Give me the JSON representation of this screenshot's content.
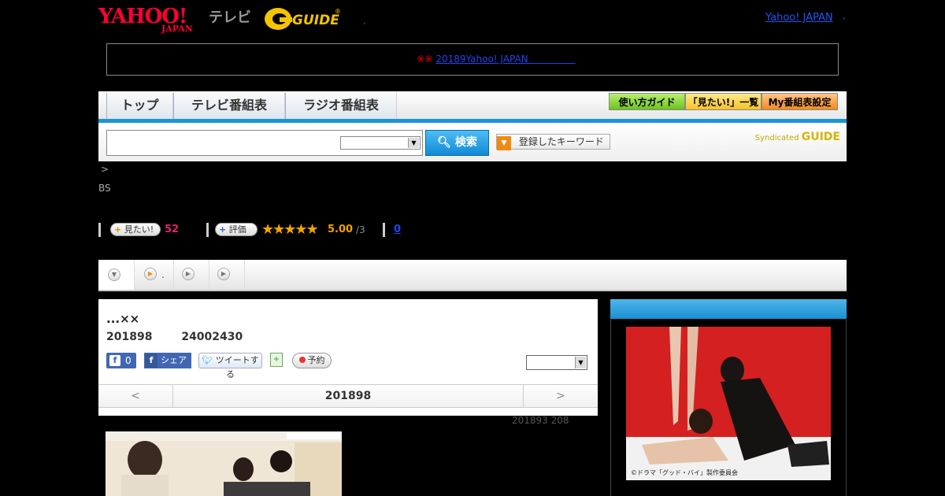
{
  "header": {
    "yahoo_logo_line1": "YAHOO!",
    "yahoo_logo_line2": "JAPAN",
    "tv_label": "テレビ",
    "gguide_logo": "GUIDE",
    "gguide_sep": ",",
    "yahoo_japan_link": "Yahoo! JAPAN",
    "yahoo_japan_sep": ","
  },
  "notice": {
    "marks": "※※",
    "link_text": "20189Yahoo! JAPAN　　　　　"
  },
  "nav": {
    "tabs": [
      "トップ",
      "テレビ番組表",
      "ラジオ番組表"
    ],
    "buttons": [
      "使い方ガイド",
      "「見たい!」一覧",
      "My番組表設定"
    ]
  },
  "search": {
    "placeholder": "",
    "select_value": "",
    "button_label": "検索",
    "keyword_button": "登録したキーワード",
    "syndicated_label": "Syndicated",
    "syndicated_brand": "GUIDE"
  },
  "breadcrumb": ">",
  "category": "BS",
  "stats": {
    "want_label": "見たい!",
    "want_count": "52",
    "rate_label": "評価",
    "stars": "★★★★★",
    "score": "5.00",
    "score_max": "/3",
    "review_count": "0"
  },
  "tabs_row": {
    "tab2_text": "."
  },
  "program": {
    "title": "...××",
    "date": "201898",
    "time": "24002430",
    "fb_like_count": "0",
    "fb_share_label": "シェア",
    "tweet_label": "ツイートする",
    "reserve_label": "予約",
    "select_value": "",
    "prev_label": "<",
    "next_label": ">",
    "nav_date": "201898",
    "updated": "201893  208"
  },
  "side": {
    "caption": "©ドラマ「グッド・バイ」製作委員会"
  },
  "colors": {
    "accent_blue": "#1a95d6",
    "want_pink": "#e0246a",
    "star_orange": "#f5a500",
    "link_blue": "#2244ee",
    "notice_red": "#ee0000"
  }
}
